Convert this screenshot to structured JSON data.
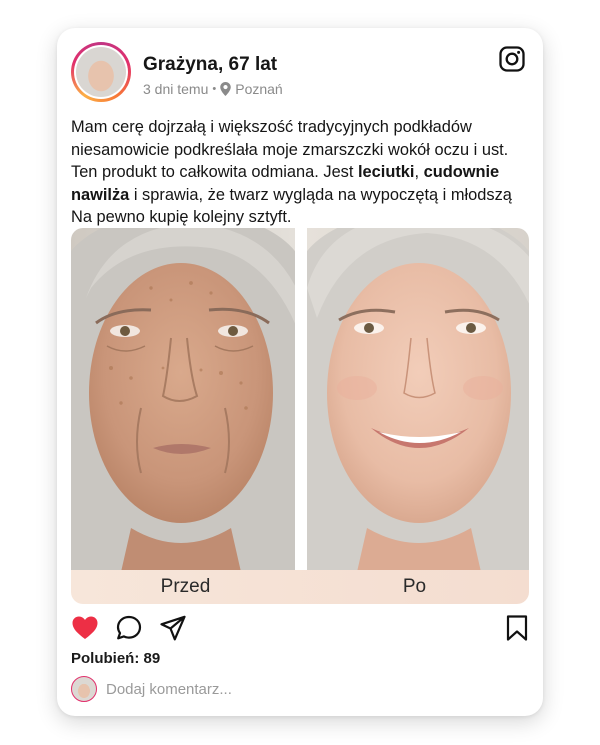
{
  "post": {
    "author": "Grażyna, 67 lat",
    "time": "3 dni temu",
    "separator": "•",
    "location": "Poznań",
    "text_part1": "Mam cerę dojrzałą i większość tradycyjnych podkładów niesamowicie podkreślała moje zmarszczki wokół oczu i ust. Ten produkt to całkowita odmiana. Jest ",
    "text_bold1": "leciutki",
    "text_part2": ", ",
    "text_bold2": "cudownie nawilża",
    "text_part3": " i sprawia, że twarz wygląda na wypoczętą i młodszą Na pewno kupię kolejny sztyft."
  },
  "photos": {
    "before_label": "Przed",
    "after_label": "Po"
  },
  "engagement": {
    "likes_text": "Polubień: 89",
    "comment_placeholder": "Dodaj komentarz..."
  },
  "icons": {
    "profile": "instagram-icon",
    "like": "heart-icon",
    "comment": "comment-icon",
    "share": "send-icon",
    "save": "bookmark-icon",
    "location": "location-pin-icon"
  },
  "colors": {
    "like_red": "#ed2f45",
    "caption_bg": "#f6e2d6",
    "muted_text": "#8a8a8a"
  }
}
